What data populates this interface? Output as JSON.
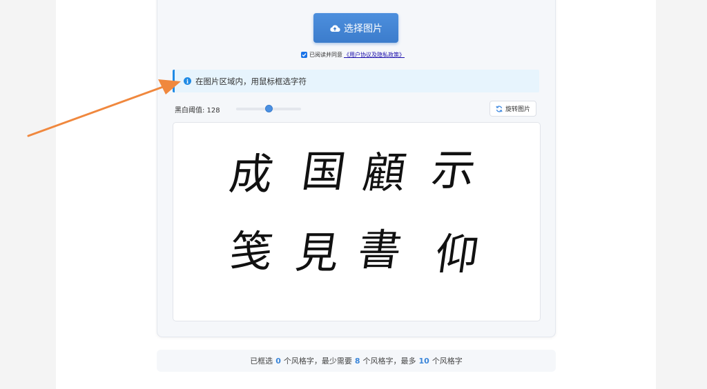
{
  "upload": {
    "label": "选择图片"
  },
  "agreement": {
    "text": "已阅读并同意",
    "link": "《用户协议及隐私政策》",
    "checked": true
  },
  "info": {
    "text": "在图片区域内，用鼠标框选字符"
  },
  "threshold": {
    "label": "黑白阈值: 128",
    "value": 128,
    "max": 255
  },
  "rotate": {
    "label": "旋转图片"
  },
  "image": {
    "row1": [
      "成",
      "国",
      "顧",
      "示"
    ],
    "row2": [
      "笺",
      "見",
      "書",
      "仰"
    ]
  },
  "footer": {
    "p1": "已框选",
    "selected": "0",
    "p2": "个风格字，最少需要",
    "min": "8",
    "p3": "个风格字，最多",
    "max": "10",
    "p4": "个风格字"
  },
  "colors": {
    "accent": "#4a90e2",
    "info_border": "#1f8ae5",
    "arrow": "#f0883e"
  }
}
